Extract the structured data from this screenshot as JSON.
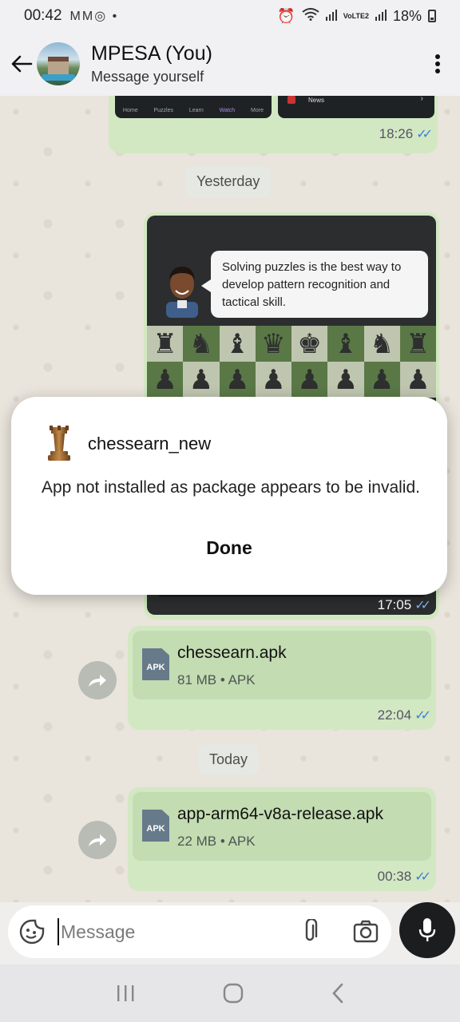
{
  "status_bar": {
    "time": "00:42",
    "notif_icons": "MM◎ •",
    "signal_text": "VoLTE2",
    "battery": "18%"
  },
  "header": {
    "title": "MPESA (You)",
    "subtitle": "Message yourself"
  },
  "chat": {
    "top_bubble_time": "18:26",
    "top_image_news_label": "News",
    "top_image_nav": [
      "Home",
      "Puzzles",
      "Learn",
      "Watch",
      "More"
    ],
    "chip_yesterday": "Yesterday",
    "chess_tip": "Solving puzzles is the best way to develop pattern recognition and tactical skill.",
    "chess_image_time": "17:05",
    "file1": {
      "name": "chessearn.apk",
      "meta": "81 MB • APK",
      "time": "22:04",
      "icon_label": "APK"
    },
    "chip_today": "Today",
    "file2": {
      "name": "app-arm64-v8a-release.apk",
      "meta": "22 MB • APK",
      "time": "00:38",
      "icon_label": "APK"
    }
  },
  "dialog": {
    "app_name": "chessearn_new",
    "message": "App not installed as package appears to be invalid.",
    "done_label": "Done"
  },
  "composer": {
    "placeholder": "Message"
  },
  "colors": {
    "outgoing_bubble": "#d2e8c2",
    "read_ticks": "#3b7fd6",
    "mic_button": "#1c1d1f"
  }
}
